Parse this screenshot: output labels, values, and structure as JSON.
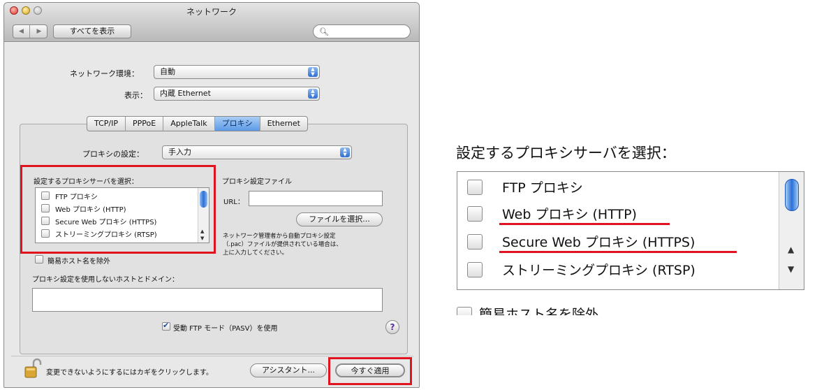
{
  "window": {
    "title": "ネットワーク",
    "nav_back": "◀",
    "nav_fwd": "▶",
    "show_all": "すべてを表示",
    "search_icon": "magnifier-icon"
  },
  "location": {
    "label": "ネットワーク環境：",
    "value": "自動"
  },
  "show": {
    "label": "表示：",
    "value": "内蔵 Ethernet"
  },
  "tabs": [
    "TCP/IP",
    "PPPoE",
    "AppleTalk",
    "プロキシ",
    "Ethernet"
  ],
  "selected_tab": "プロキシ",
  "proxy_setting": {
    "label": "プロキシの設定：",
    "value": "手入力"
  },
  "server_section": {
    "label": "設定するプロキシサーバを選択：",
    "items": [
      "FTP プロキシ",
      "Web プロキシ (HTTP)",
      "Secure Web プロキシ (HTTPS)",
      "ストリーミングプロキシ (RTSP)"
    ]
  },
  "config_file": {
    "label": "プロキシ設定ファイル",
    "url_label": "URL：",
    "url_value": "",
    "choose_button": "ファイルを選択...",
    "note_line1": "ネットワーク管理者から自動プロキシ設定",
    "note_line2": "（.pac）ファイルが提供されている場合は、",
    "note_line3": "上に入力してください。"
  },
  "exclude_simple": {
    "label": "簡易ホスト名を除外",
    "checked": false
  },
  "bypass": {
    "label": "プロキシ設定を使用しないホストとドメイン：",
    "value": ""
  },
  "pasv": {
    "label": "受動 FTP モード（PASV）を使用",
    "checked": true
  },
  "help_label": "?",
  "footer": {
    "lock_text": "変更できないようにするにはカギをクリックします。",
    "assistant_button": "アシスタント...",
    "apply_button": "今すぐ適用"
  },
  "zoom": {
    "title": "設定するプロキシサーバを選択：",
    "items": [
      "FTP プロキシ",
      "Web プロキシ (HTTP)",
      "Secure Web プロキシ (HTTPS)",
      "ストリーミングプロキシ (RTSP)"
    ],
    "cut_label": "簡易ホスト名を除外"
  },
  "colors": {
    "highlight": "#e0141e",
    "accent": "#2f6fd0"
  }
}
